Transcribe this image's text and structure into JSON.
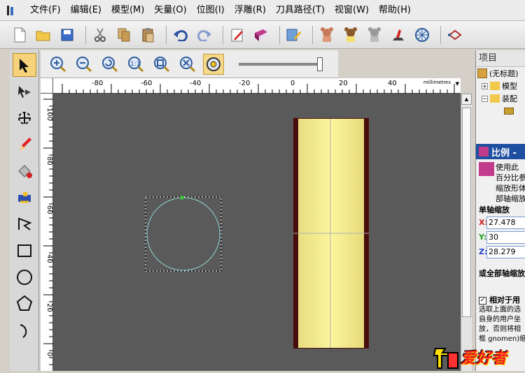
{
  "app": {
    "icon": "app-logo-icon"
  },
  "menu": [
    {
      "label": "文件(F)"
    },
    {
      "label": "编辑(E)"
    },
    {
      "label": "模型(M)"
    },
    {
      "label": "矢量(O)"
    },
    {
      "label": "位图(I)"
    },
    {
      "label": "浮雕(R)"
    },
    {
      "label": "刀具路径(T)"
    },
    {
      "label": "视窗(W)"
    },
    {
      "label": "帮助(H)"
    }
  ],
  "toolbar_icons": [
    "new-file-icon",
    "open-folder-icon",
    "save-icon",
    "cut-icon",
    "copy-icon",
    "paste-icon",
    "undo-icon",
    "redo-icon",
    "edit-notes-icon",
    "book-icon",
    "wizard-icon",
    "teddy-bear-relief-icon",
    "bear-relief-icon",
    "bear-gray-icon",
    "red-tool-icon",
    "globe-icon",
    "vector-tool-icon"
  ],
  "view_icons": [
    "zoom-in-icon",
    "zoom-out-icon",
    "zoom-previous-icon",
    "zoom-1to1-icon",
    "zoom-fit-icon",
    "zoom-all-icon",
    "view-settings-icon"
  ],
  "ruler": {
    "units": "millimetres",
    "h_ticks": [
      "-80",
      "-60",
      "-40",
      "-20",
      "0",
      "20",
      "40"
    ],
    "v_ticks": [
      "100",
      "80",
      "60",
      "40",
      "20",
      "0"
    ]
  },
  "project": {
    "header": "项目",
    "tree": [
      {
        "label": "(无标题)"
      },
      {
        "label": "模型"
      },
      {
        "label": "装配"
      }
    ]
  },
  "scale_panel": {
    "title": "比例 -",
    "description": "使用此\n百分比参数在\n缩放形体，或\n部轴缩放形体",
    "single_axis_label": "单轴缩放",
    "x_label": "X:",
    "y_label": "Y:",
    "z_label": "Z:",
    "x_value": "27.478",
    "y_value": "30",
    "z_value": "28.279",
    "all_axes_label": "或全部轴缩放",
    "relative_label": "相对于用",
    "relative_desc": "选取上面的选\n自身的用户坐\n放，否则将相\n框 gnomen)缩"
  },
  "watermark": {
    "text": "爱好者"
  },
  "colors": {
    "canvas": "#5a5a5a",
    "relief_fill": "#f4ee9a",
    "relief_border": "#4a0d0d",
    "selection_circle": "#8fd3d3",
    "panel_header": "#1e4fa0"
  }
}
